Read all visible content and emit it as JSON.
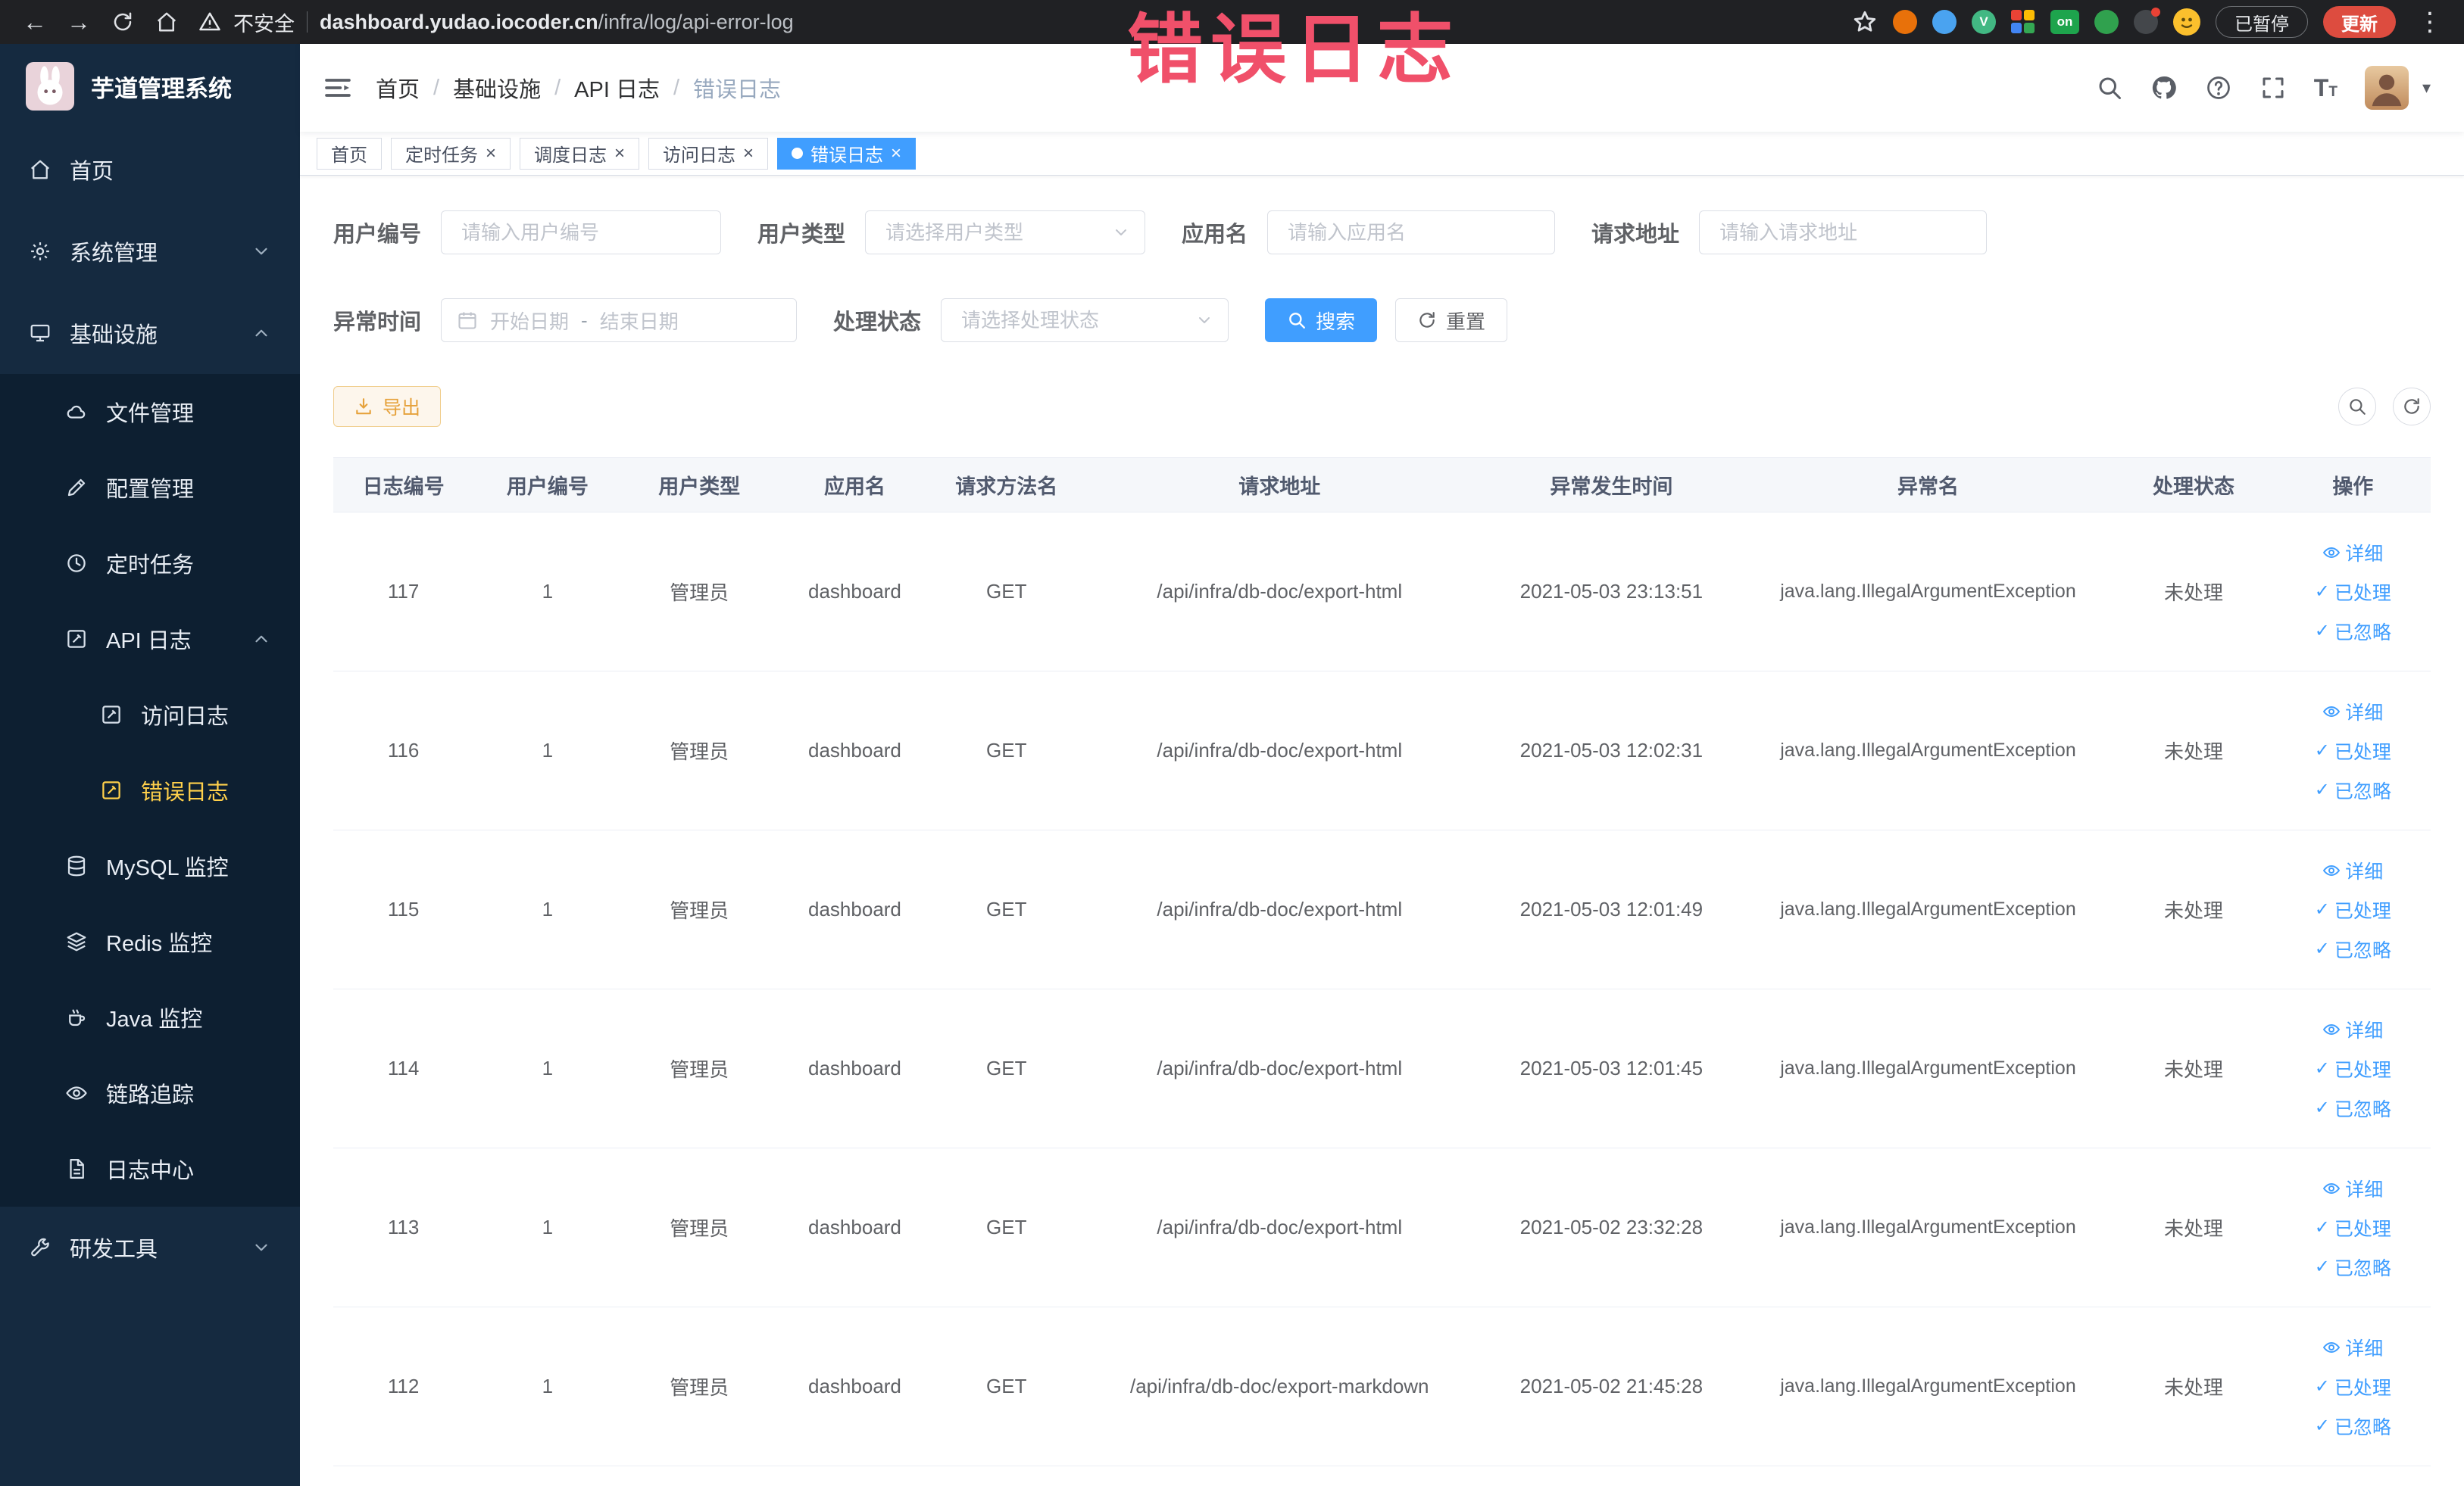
{
  "colors": {
    "primary": "#409EFF",
    "warning": "#E6A23C",
    "sidebar_active": "#FFD04B",
    "annotation_red": "#F0506A"
  },
  "annotation": {
    "text": "错误日志"
  },
  "browser": {
    "security_label": "不安全",
    "url_domain": "dashboard.yudao.iocoder.cn",
    "url_path": "/infra/log/api-error-log",
    "extension_on_badge": "on",
    "paused_button": "已暂停",
    "update_button": "更新"
  },
  "sidebar": {
    "logo_title": "芋道管理系统",
    "menu": [
      {
        "label": "首页"
      },
      {
        "label": "系统管理"
      },
      {
        "label": "基础设施"
      },
      {
        "label": "文件管理"
      },
      {
        "label": "配置管理"
      },
      {
        "label": "定时任务"
      },
      {
        "label": "API 日志"
      },
      {
        "label": "访问日志"
      },
      {
        "label": "错误日志"
      },
      {
        "label": "MySQL 监控"
      },
      {
        "label": "Redis 监控"
      },
      {
        "label": "Java 监控"
      },
      {
        "label": "链路追踪"
      },
      {
        "label": "日志中心"
      },
      {
        "label": "研发工具"
      }
    ]
  },
  "header": {
    "breadcrumb": [
      "首页",
      "基础设施",
      "API 日志",
      "错误日志"
    ]
  },
  "tabs": [
    {
      "label": "首页"
    },
    {
      "label": "定时任务"
    },
    {
      "label": "调度日志"
    },
    {
      "label": "访问日志"
    },
    {
      "label": "错误日志"
    }
  ],
  "filters": {
    "user_id_label": "用户编号",
    "user_id_placeholder": "请输入用户编号",
    "user_type_label": "用户类型",
    "user_type_placeholder": "请选择用户类型",
    "app_name_label": "应用名",
    "app_name_placeholder": "请输入应用名",
    "request_url_label": "请求地址",
    "request_url_placeholder": "请输入请求地址",
    "time_label": "异常时间",
    "time_start_placeholder": "开始日期",
    "time_separator": "-",
    "time_end_placeholder": "结束日期",
    "status_label": "处理状态",
    "status_placeholder": "请选择处理状态",
    "search_button": "搜索",
    "reset_button": "重置"
  },
  "toolbar": {
    "export_button": "导出"
  },
  "table": {
    "columns": [
      "日志编号",
      "用户编号",
      "用户类型",
      "应用名",
      "请求方法名",
      "请求地址",
      "异常发生时间",
      "异常名",
      "处理状态",
      "操作"
    ],
    "actions": {
      "detail": "详细",
      "processed": "已处理",
      "ignored": "已忽略"
    },
    "rows": [
      {
        "id": "117",
        "user_id": "1",
        "user_type": "管理员",
        "app": "dashboard",
        "method": "GET",
        "url": "/api/infra/db-doc/export-html",
        "time": "2021-05-03 23:13:51",
        "exception": "java.lang.IllegalArgumentException",
        "status": "未处理"
      },
      {
        "id": "116",
        "user_id": "1",
        "user_type": "管理员",
        "app": "dashboard",
        "method": "GET",
        "url": "/api/infra/db-doc/export-html",
        "time": "2021-05-03 12:02:31",
        "exception": "java.lang.IllegalArgumentException",
        "status": "未处理"
      },
      {
        "id": "115",
        "user_id": "1",
        "user_type": "管理员",
        "app": "dashboard",
        "method": "GET",
        "url": "/api/infra/db-doc/export-html",
        "time": "2021-05-03 12:01:49",
        "exception": "java.lang.IllegalArgumentException",
        "status": "未处理"
      },
      {
        "id": "114",
        "user_id": "1",
        "user_type": "管理员",
        "app": "dashboard",
        "method": "GET",
        "url": "/api/infra/db-doc/export-html",
        "time": "2021-05-03 12:01:45",
        "exception": "java.lang.IllegalArgumentException",
        "status": "未处理"
      },
      {
        "id": "113",
        "user_id": "1",
        "user_type": "管理员",
        "app": "dashboard",
        "method": "GET",
        "url": "/api/infra/db-doc/export-html",
        "time": "2021-05-02 23:32:28",
        "exception": "java.lang.IllegalArgumentException",
        "status": "未处理"
      },
      {
        "id": "112",
        "user_id": "1",
        "user_type": "管理员",
        "app": "dashboard",
        "method": "GET",
        "url": "/api/infra/db-doc/export-markdown",
        "time": "2021-05-02 21:45:28",
        "exception": "java.lang.IllegalArgumentException",
        "status": "未处理"
      }
    ]
  }
}
